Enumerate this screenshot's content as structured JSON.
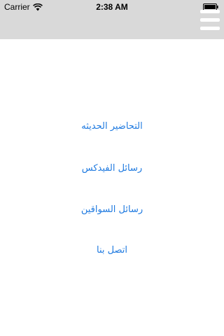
{
  "status_bar": {
    "carrier": "Carrier",
    "time": "2:38 AM",
    "icons": [
      "wifi-icon",
      "battery-icon"
    ]
  },
  "header": {
    "background": "#d9d9d9",
    "menu_icon": "hamburger-menu-icon"
  },
  "menu": {
    "link_color": "#1f7ae0",
    "items": [
      {
        "label": "التحاضير الحديثه"
      },
      {
        "label": "رسائل الفيدكس"
      },
      {
        "label": "رسائل السواقين"
      },
      {
        "label": "اتصل بنا"
      }
    ]
  }
}
